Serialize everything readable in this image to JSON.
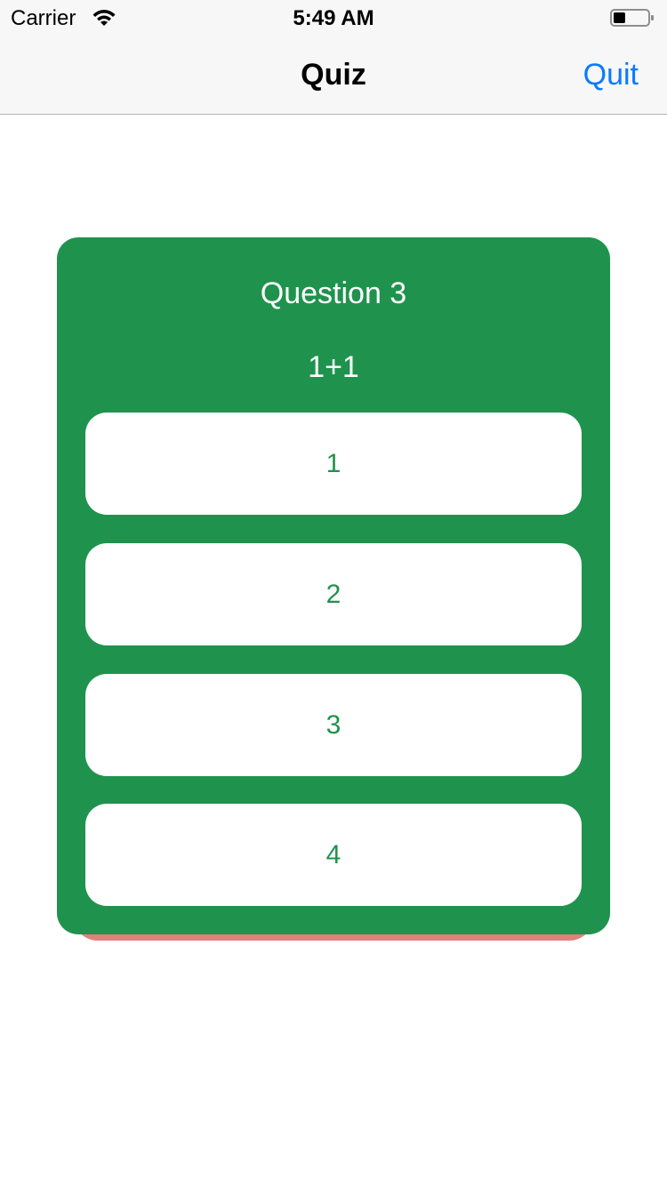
{
  "status_bar": {
    "carrier": "Carrier",
    "time": "5:49 AM",
    "battery_level": 0.35
  },
  "nav": {
    "title": "Quiz",
    "quit_label": "Quit"
  },
  "quiz": {
    "question_title": "Question 3",
    "question_text": "1+1",
    "answers": [
      "1",
      "2",
      "3",
      "4"
    ]
  },
  "colors": {
    "card": "#1f934d",
    "back_card": "#e2807a",
    "link": "#0a7aff",
    "answer_text": "#1f934d"
  },
  "icons": {
    "wifi": "wifi-icon",
    "battery": "battery-icon"
  }
}
